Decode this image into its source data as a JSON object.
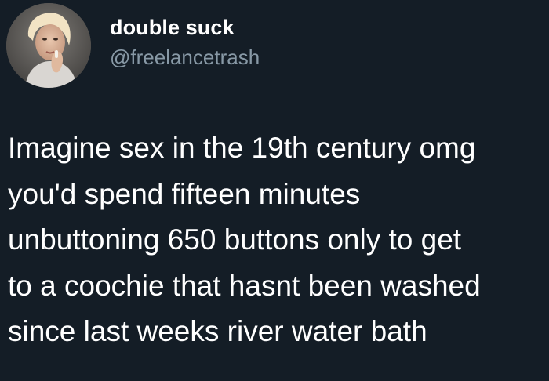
{
  "tweet": {
    "author": {
      "display_name": "double suck",
      "handle": "@freelancetrash"
    },
    "text_lines": [
      "Imagine sex in the 19th century omg",
      "you'd spend fifteen minutes",
      "unbuttoning 650 buttons only to get",
      "to a coochie that hasnt been washed",
      "since last weeks river water bath"
    ]
  },
  "colors": {
    "background": "#141d26",
    "text": "#ffffff",
    "handle": "#8899a6"
  }
}
